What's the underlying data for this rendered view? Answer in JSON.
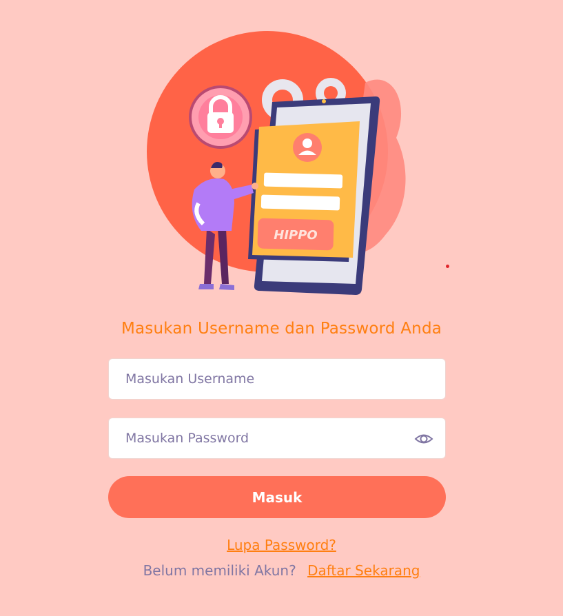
{
  "illustration": {
    "brand_text": "HIPPO"
  },
  "login": {
    "heading": "Masukan Username dan Password Anda",
    "username_placeholder": "Masukan Username",
    "password_placeholder": "Masukan Password",
    "submit_label": "Masuk",
    "forgot_password_link": "Lupa Password?",
    "register_prompt": "Belum memiliki Akun?",
    "register_link": "Daftar Sekarang"
  },
  "colors": {
    "background": "#ffcac3",
    "accent": "#ff7f11",
    "button": "#ff7058",
    "muted_text": "#8076a3"
  },
  "icons": {
    "password_toggle": "eye-icon"
  }
}
